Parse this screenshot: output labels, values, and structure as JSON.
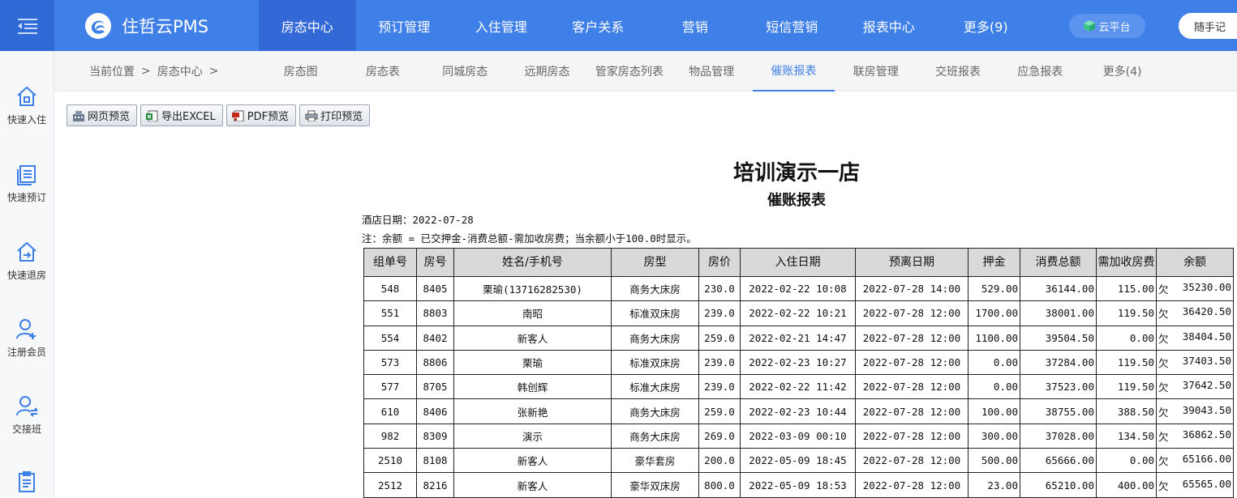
{
  "app": {
    "brand": "住哲云PMS"
  },
  "nav": [
    "房态中心",
    "预订管理",
    "入住管理",
    "客户关系",
    "营销",
    "短信营销",
    "报表中心",
    "更多(9)"
  ],
  "nav_active_index": 0,
  "top_buttons": {
    "cloud": "云平台",
    "note": "随手记"
  },
  "sidebar": [
    {
      "label": "快速入住",
      "icon": "home-icon"
    },
    {
      "label": "快速预订",
      "icon": "book-icon"
    },
    {
      "label": "快速退房",
      "icon": "checkout-icon"
    },
    {
      "label": "注册会员",
      "icon": "add-user-icon"
    },
    {
      "label": "交接班",
      "icon": "shift-icon"
    },
    {
      "label": "",
      "icon": "clipboard-icon"
    }
  ],
  "breadcrumb": {
    "prefix": "当前位置",
    "sep1": ">",
    "item": "房态中心",
    "sep2": ">"
  },
  "subtabs": [
    "房态图",
    "房态表",
    "同城房态",
    "远期房态",
    "管家房态列表",
    "物品管理",
    "催账报表",
    "联房管理",
    "交班报表",
    "应急报表",
    "更多(4)"
  ],
  "subtab_active_index": 6,
  "toolbar": {
    "web_preview": "网页预览",
    "export_excel": "导出EXCEL",
    "pdf_preview": "PDF预览",
    "print_preview": "打印预览"
  },
  "report": {
    "title": "培训演示一店",
    "subtitle": "催账报表",
    "hotel_date": "酒店日期：2022-07-28",
    "note": "注：余额 = 已交押金-消费总额-需加收房费；当余额小于100.0时显示。",
    "headers": [
      "组单号",
      "房号",
      "姓名/手机号",
      "房型",
      "房价",
      "入住日期",
      "预离日期",
      "押金",
      "消费总额",
      "需加收房费",
      "余额"
    ],
    "rows": [
      [
        "548",
        "8405",
        "栗瑜(13716282530)",
        "商务大床房",
        "230.0",
        "2022-02-22 10:08",
        "2022-07-28 14:00",
        "529.00",
        "36144.00",
        "115.00",
        "欠",
        "35230.00"
      ],
      [
        "551",
        "8803",
        "南昭",
        "标准双床房",
        "239.0",
        "2022-02-22 10:21",
        "2022-07-28 12:00",
        "1700.00",
        "38001.00",
        "119.50",
        "欠",
        "36420.50"
      ],
      [
        "554",
        "8402",
        "新客人",
        "商务大床房",
        "259.0",
        "2022-02-21 14:47",
        "2022-07-28 12:00",
        "1100.00",
        "39504.50",
        "0.00",
        "欠",
        "38404.50"
      ],
      [
        "573",
        "8806",
        "栗瑜",
        "标准双床房",
        "239.0",
        "2022-02-23 10:27",
        "2022-07-28 12:00",
        "0.00",
        "37284.00",
        "119.50",
        "欠",
        "37403.50"
      ],
      [
        "577",
        "8705",
        "韩创辉",
        "标准大床房",
        "239.0",
        "2022-02-22 11:42",
        "2022-07-28 12:00",
        "0.00",
        "37523.00",
        "119.50",
        "欠",
        "37642.50"
      ],
      [
        "610",
        "8406",
        "张新艳",
        "商务大床房",
        "259.0",
        "2022-02-23 10:44",
        "2022-07-28 12:00",
        "100.00",
        "38755.00",
        "388.50",
        "欠",
        "39043.50"
      ],
      [
        "982",
        "8309",
        "演示",
        "商务大床房",
        "269.0",
        "2022-03-09 00:10",
        "2022-07-28 12:00",
        "300.00",
        "37028.00",
        "134.50",
        "欠",
        "36862.50"
      ],
      [
        "2510",
        "8108",
        "新客人",
        "豪华套房",
        "200.0",
        "2022-05-09 18:45",
        "2022-07-28 12:00",
        "500.00",
        "65666.00",
        "0.00",
        "欠",
        "65166.00"
      ],
      [
        "2512",
        "8216",
        "新客人",
        "豪华双床房",
        "800.0",
        "2022-05-09 18:53",
        "2022-07-28 12:00",
        "23.00",
        "65210.00",
        "400.00",
        "欠",
        "65565.00"
      ]
    ]
  }
}
